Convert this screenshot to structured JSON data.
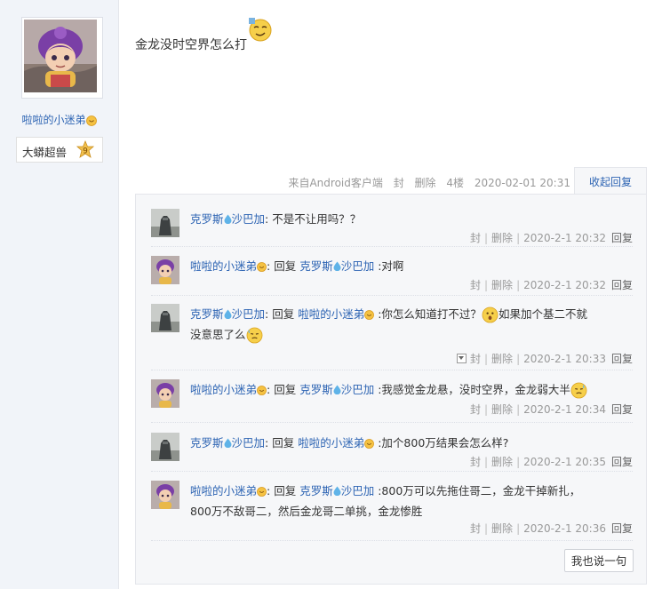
{
  "author": {
    "name": "啦啦的小迷弟",
    "badge_title": "大蟒超兽",
    "badge_level": "9"
  },
  "post": {
    "content": "金龙没时空界怎么打",
    "source": "来自Android客户端",
    "action_seal": "封",
    "action_delete": "删除",
    "floor": "4楼",
    "time": "2020-02-01 20:31",
    "toggle_replies": "收起回复"
  },
  "comments": [
    {
      "user": "克罗斯",
      "user_suffix": "沙巴加",
      "avatar": "robot",
      "reply_to": "",
      "reply_to_suffix": "",
      "text": ": 不是不让用吗？？",
      "time": "2020-2-1 20:32"
    },
    {
      "user": "啦啦的小迷弟",
      "user_suffix": "",
      "avatar": "girl",
      "reply_to": "克罗斯",
      "reply_to_suffix": "沙巴加",
      "text": ":对啊",
      "time": "2020-2-1 20:32"
    },
    {
      "user": "克罗斯",
      "user_suffix": "沙巴加",
      "avatar": "robot",
      "reply_to": "啦啦的小迷弟",
      "reply_to_suffix": "",
      "text": ":你怎么知道打不过？",
      "text2": "如果加个基二不就",
      "text3": "没意思了么",
      "time": "2020-2-1 20:33"
    },
    {
      "user": "啦啦的小迷弟",
      "user_suffix": "",
      "avatar": "girl",
      "reply_to": "克罗斯",
      "reply_to_suffix": "沙巴加",
      "text": ":我感觉金龙悬，没时空界，金龙弱大半",
      "time": "2020-2-1 20:34"
    },
    {
      "user": "克罗斯",
      "user_suffix": "沙巴加",
      "avatar": "robot",
      "reply_to": "啦啦的小迷弟",
      "reply_to_suffix": "",
      "text": ":加个800万结果会怎么样?",
      "time": "2020-2-1 20:35"
    },
    {
      "user": "啦啦的小迷弟",
      "user_suffix": "",
      "avatar": "girl",
      "reply_to": "克罗斯",
      "reply_to_suffix": "沙巴加",
      "text": ":800万可以先拖住哥二，金龙干掉新扎，",
      "text2": "800万不敌哥二，然后金龙哥二单挑，金龙惨胜",
      "time": "2020-2-1 20:36"
    }
  ],
  "labels": {
    "reply_word": "回复",
    "seal": "封",
    "delete": "删除",
    "reply": "回复",
    "say_button": "我也说一句"
  },
  "colors": {
    "link": "#2d64b3",
    "sidebar_bg": "#f1f4f9",
    "comments_bg": "#f6f7f9"
  }
}
